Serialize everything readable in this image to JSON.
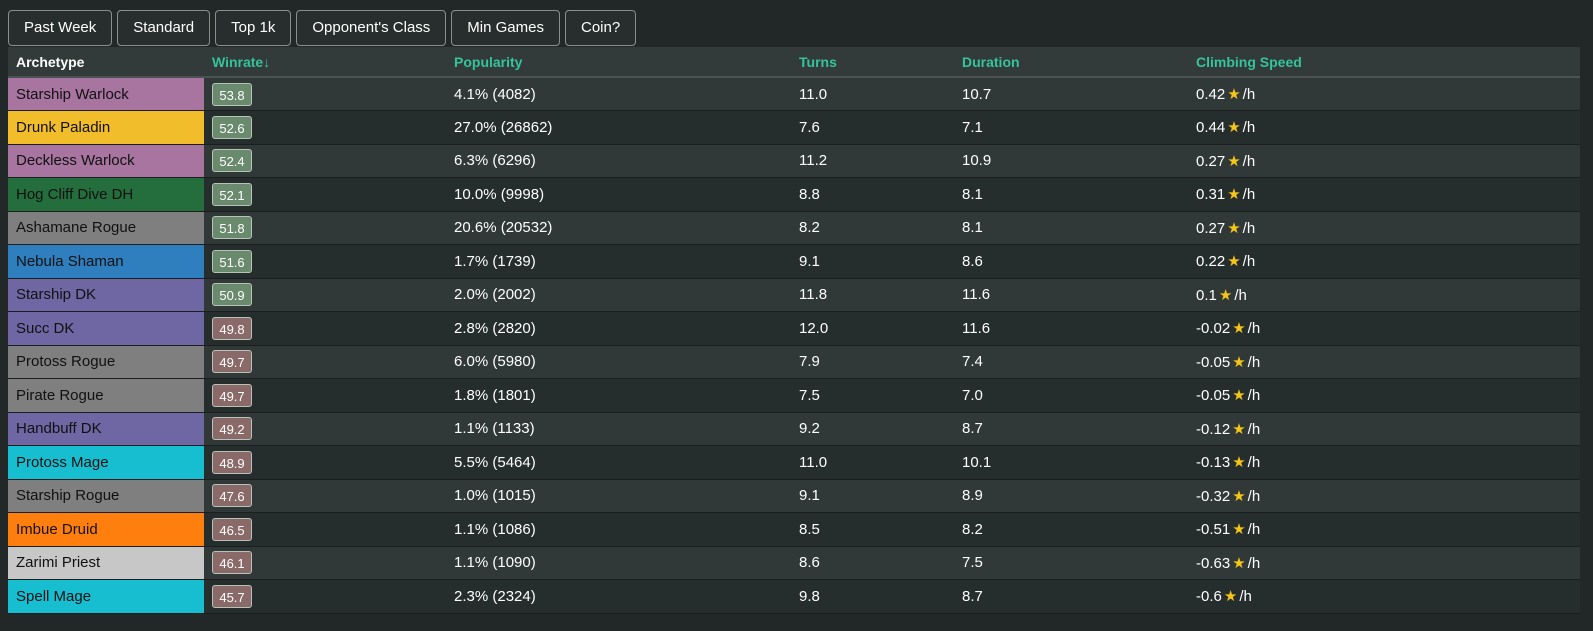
{
  "filters": [
    {
      "label": "Past Week",
      "name": "past-week-button"
    },
    {
      "label": "Standard",
      "name": "standard-button"
    },
    {
      "label": "Top 1k",
      "name": "top-1k-button"
    },
    {
      "label": "Opponent's Class",
      "name": "opponents-class-button"
    },
    {
      "label": "Min Games",
      "name": "min-games-button"
    },
    {
      "label": "Coin?",
      "name": "coin-button"
    }
  ],
  "table": {
    "headers": {
      "archetype": "Archetype",
      "winrate": "Winrate↓",
      "popularity": "Popularity",
      "turns": "Turns",
      "duration": "Duration",
      "climbing": "Climbing Speed"
    },
    "unit_suffix": "/h",
    "star_icon": "star-icon",
    "rows": [
      {
        "archetype": "Starship Warlock",
        "color": "#a775a0",
        "winrate": "53.8",
        "positive": true,
        "popularity": "4.1% (4082)",
        "turns": "11.0",
        "duration": "10.7",
        "climbing": "0.42"
      },
      {
        "archetype": "Drunk Paladin",
        "color": "#f2bd2b",
        "winrate": "52.6",
        "positive": true,
        "popularity": "27.0% (26862)",
        "turns": "7.6",
        "duration": "7.1",
        "climbing": "0.44"
      },
      {
        "archetype": "Deckless Warlock",
        "color": "#a775a0",
        "winrate": "52.4",
        "positive": true,
        "popularity": "6.3% (6296)",
        "turns": "11.2",
        "duration": "10.9",
        "climbing": "0.27"
      },
      {
        "archetype": "Hog Cliff Dive DH",
        "color": "#246d3c",
        "winrate": "52.1",
        "positive": true,
        "popularity": "10.0% (9998)",
        "turns": "8.8",
        "duration": "8.1",
        "climbing": "0.31"
      },
      {
        "archetype": "Ashamane Rogue",
        "color": "#7f7f7f",
        "winrate": "51.8",
        "positive": true,
        "popularity": "20.6% (20532)",
        "turns": "8.2",
        "duration": "8.1",
        "climbing": "0.27"
      },
      {
        "archetype": "Nebula Shaman",
        "color": "#2f7ebd",
        "winrate": "51.6",
        "positive": true,
        "popularity": "1.7% (1739)",
        "turns": "9.1",
        "duration": "8.6",
        "climbing": "0.22"
      },
      {
        "archetype": "Starship DK",
        "color": "#6f67a3",
        "winrate": "50.9",
        "positive": true,
        "popularity": "2.0% (2002)",
        "turns": "11.8",
        "duration": "11.6",
        "climbing": "0.1"
      },
      {
        "archetype": "Succ DK",
        "color": "#6f67a3",
        "winrate": "49.8",
        "positive": false,
        "popularity": "2.8% (2820)",
        "turns": "12.0",
        "duration": "11.6",
        "climbing": "-0.02"
      },
      {
        "archetype": "Protoss Rogue",
        "color": "#7f7f7f",
        "winrate": "49.7",
        "positive": false,
        "popularity": "6.0% (5980)",
        "turns": "7.9",
        "duration": "7.4",
        "climbing": "-0.05"
      },
      {
        "archetype": "Pirate Rogue",
        "color": "#7f7f7f",
        "winrate": "49.7",
        "positive": false,
        "popularity": "1.8% (1801)",
        "turns": "7.5",
        "duration": "7.0",
        "climbing": "-0.05"
      },
      {
        "archetype": "Handbuff DK",
        "color": "#6f67a3",
        "winrate": "49.2",
        "positive": false,
        "popularity": "1.1% (1133)",
        "turns": "9.2",
        "duration": "8.7",
        "climbing": "-0.12"
      },
      {
        "archetype": "Protoss Mage",
        "color": "#17bed0",
        "winrate": "48.9",
        "positive": false,
        "popularity": "5.5% (5464)",
        "turns": "11.0",
        "duration": "10.1",
        "climbing": "-0.13"
      },
      {
        "archetype": "Starship Rogue",
        "color": "#7f7f7f",
        "winrate": "47.6",
        "positive": false,
        "popularity": "1.0% (1015)",
        "turns": "9.1",
        "duration": "8.9",
        "climbing": "-0.32"
      },
      {
        "archetype": "Imbue Druid",
        "color": "#ff7f0e",
        "winrate": "46.5",
        "positive": false,
        "popularity": "1.1% (1086)",
        "turns": "8.5",
        "duration": "8.2",
        "climbing": "-0.51"
      },
      {
        "archetype": "Zarimi Priest",
        "color": "#c7c7c7",
        "winrate": "46.1",
        "positive": false,
        "popularity": "1.1% (1090)",
        "turns": "8.6",
        "duration": "7.5",
        "climbing": "-0.63"
      },
      {
        "archetype": "Spell Mage",
        "color": "#17bed0",
        "winrate": "45.7",
        "positive": false,
        "popularity": "2.3% (2324)",
        "turns": "9.8",
        "duration": "8.7",
        "climbing": "-0.6"
      }
    ]
  }
}
